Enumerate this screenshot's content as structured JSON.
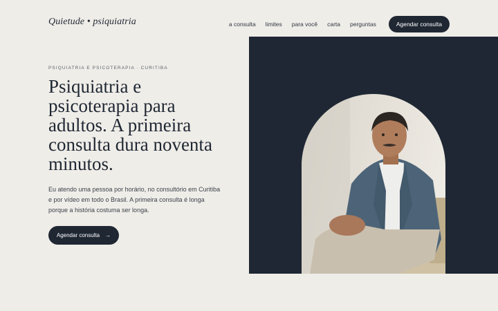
{
  "brand": {
    "name": "Quietude • psiquiatria"
  },
  "nav": {
    "items": [
      {
        "label": "a consulta"
      },
      {
        "label": "limites"
      },
      {
        "label": "para você"
      },
      {
        "label": "carta"
      },
      {
        "label": "perguntas"
      }
    ],
    "cta_label": "Agendar consulta"
  },
  "hero": {
    "eyebrow": "PSIQUIATRIA E PSICOTERAPIA · CURITIBA",
    "headline": "Psiquiatria e psicoterapia para adultos. A primeira consulta dura noventa minutos.",
    "lede": "Eu atendo uma pessoa por horário, no consultório em Curitiba e por vídeo em todo o Brasil. A primeira consulta é longa porque a história costuma ser longa.",
    "button_label": "Agendar consulta",
    "button_arrow": "→"
  },
  "colors": {
    "background": "#efede8",
    "ink": "#1f2733",
    "panel": "#1e2733",
    "cardigan": "#4d6478",
    "trousers": "#c9bfae",
    "chair": "#cfc2a4"
  },
  "portrait": {
    "icon": "portrait-photo"
  }
}
